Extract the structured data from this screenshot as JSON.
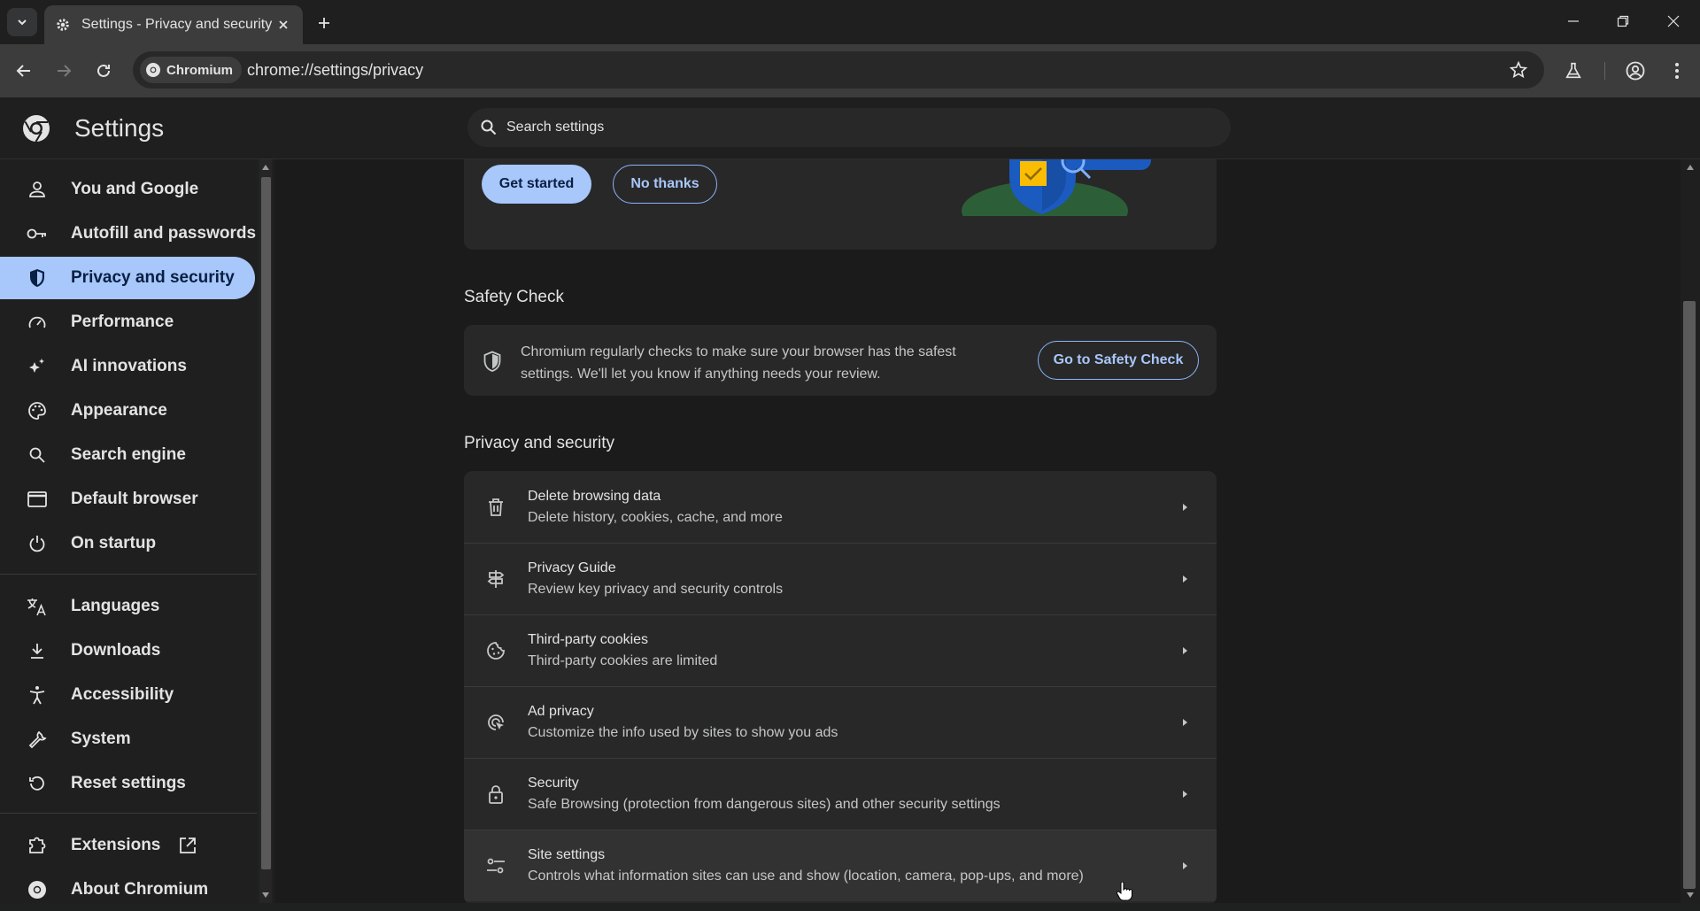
{
  "browser": {
    "tab_title": "Settings - Privacy and security",
    "site_chip": "Chromium",
    "url": "chrome://settings/privacy"
  },
  "header": {
    "title": "Settings",
    "search_placeholder": "Search settings"
  },
  "sidebar": {
    "items": [
      {
        "label": "You and Google",
        "icon": "person-icon"
      },
      {
        "label": "Autofill and passwords",
        "icon": "key-icon"
      },
      {
        "label": "Privacy and security",
        "icon": "shield-icon",
        "active": true
      },
      {
        "label": "Performance",
        "icon": "speedometer-icon"
      },
      {
        "label": "AI innovations",
        "icon": "sparkle-icon"
      },
      {
        "label": "Appearance",
        "icon": "palette-icon"
      },
      {
        "label": "Search engine",
        "icon": "search-icon"
      },
      {
        "label": "Default browser",
        "icon": "browser-window-icon"
      },
      {
        "label": "On startup",
        "icon": "power-icon"
      },
      {
        "label": "Languages",
        "icon": "translate-icon"
      },
      {
        "label": "Downloads",
        "icon": "download-icon"
      },
      {
        "label": "Accessibility",
        "icon": "accessibility-icon"
      },
      {
        "label": "System",
        "icon": "wrench-icon"
      },
      {
        "label": "Reset settings",
        "icon": "reset-icon"
      },
      {
        "label": "Extensions",
        "icon": "puzzle-icon"
      },
      {
        "label": "About Chromium",
        "icon": "chromium-icon"
      }
    ]
  },
  "promo": {
    "get_started": "Get started",
    "no_thanks": "No thanks"
  },
  "safety_check": {
    "heading": "Safety Check",
    "text_line1": "Chromium regularly checks to make sure your browser has the safest",
    "text_line2": "settings. We'll let you know if anything needs your review.",
    "button": "Go to Safety Check"
  },
  "privacy": {
    "heading": "Privacy and security",
    "rows": [
      {
        "title": "Delete browsing data",
        "sub": "Delete history, cookies, cache, and more",
        "icon": "trash-icon"
      },
      {
        "title": "Privacy Guide",
        "sub": "Review key privacy and security controls",
        "icon": "signpost-icon"
      },
      {
        "title": "Third-party cookies",
        "sub": "Third-party cookies are limited",
        "icon": "cookie-icon"
      },
      {
        "title": "Ad privacy",
        "sub": "Customize the info used by sites to show you ads",
        "icon": "ad-privacy-icon"
      },
      {
        "title": "Security",
        "sub": "Safe Browsing (protection from dangerous sites) and other security settings",
        "icon": "lock-icon"
      },
      {
        "title": "Site settings",
        "sub": "Controls what information sites can use and show (location, camera, pop-ups, and more)",
        "icon": "sliders-icon"
      }
    ]
  },
  "colors": {
    "accent": "#a8c7fa",
    "background": "#1b1b1b",
    "card": "#282828"
  }
}
